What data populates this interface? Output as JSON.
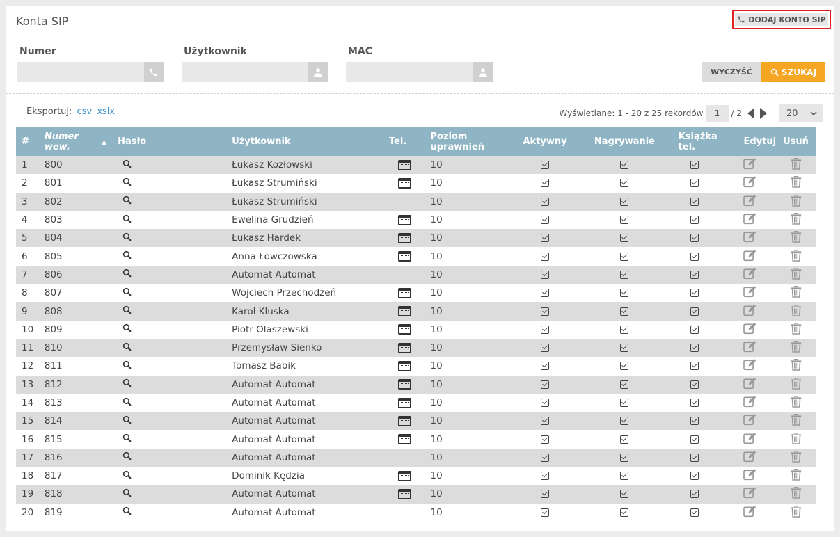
{
  "header": {
    "title": "Konta SIP",
    "add_button_label": "DODAJ KONTO SIP"
  },
  "filters": {
    "numer_label": "Numer",
    "uzytkownik_label": "Użytkownik",
    "mac_label": "MAC",
    "clear_label": "WYCZYŚĆ",
    "search_label": "SZUKAJ"
  },
  "export": {
    "label": "Eksportuj:",
    "csv": "csv",
    "xslx": "xslx"
  },
  "pager": {
    "info": "Wyświetlane: 1 - 20 z 25 rekordów",
    "current_page": "1",
    "total_pages": "/ 2",
    "per_page": "20"
  },
  "table": {
    "headers": {
      "index": "#",
      "numer_line1": "Numer",
      "numer_line2": "wew.",
      "haslo": "Hasło",
      "uzytkownik": "Użytkownik",
      "tel": "Tel.",
      "poziom_line1": "Poziom",
      "poziom_line2": "uprawnień",
      "aktywny": "Aktywny",
      "nagrywanie": "Nagrywanie",
      "ksiazka_line1": "Książka",
      "ksiazka_line2": "tel.",
      "edytuj": "Edytuj",
      "usun": "Usuń"
    },
    "rows": [
      {
        "idx": "1",
        "numer": "800",
        "user": "Łukasz Kozłowski",
        "tel": true,
        "poziom": "10"
      },
      {
        "idx": "2",
        "numer": "801",
        "user": "Łukasz Strumiński",
        "tel": true,
        "poziom": "10"
      },
      {
        "idx": "3",
        "numer": "802",
        "user": "Łukasz Strumiński",
        "tel": false,
        "poziom": "10"
      },
      {
        "idx": "4",
        "numer": "803",
        "user": "Ewelina Grudzień",
        "tel": true,
        "poziom": "10"
      },
      {
        "idx": "5",
        "numer": "804",
        "user": "Łukasz Hardek",
        "tel": true,
        "poziom": "10"
      },
      {
        "idx": "6",
        "numer": "805",
        "user": "Anna Łowczowska",
        "tel": true,
        "poziom": "10"
      },
      {
        "idx": "7",
        "numer": "806",
        "user": "Automat Automat",
        "tel": false,
        "poziom": "10"
      },
      {
        "idx": "8",
        "numer": "807",
        "user": "Wojciech Przechodzeń",
        "tel": true,
        "poziom": "10"
      },
      {
        "idx": "9",
        "numer": "808",
        "user": "Karol Kluska",
        "tel": true,
        "poziom": "10"
      },
      {
        "idx": "10",
        "numer": "809",
        "user": "Piotr Olaszewski",
        "tel": true,
        "poziom": "10"
      },
      {
        "idx": "11",
        "numer": "810",
        "user": "Przemysław Sienko",
        "tel": true,
        "poziom": "10"
      },
      {
        "idx": "12",
        "numer": "811",
        "user": "Tomasz Babik",
        "tel": true,
        "poziom": "10"
      },
      {
        "idx": "13",
        "numer": "812",
        "user": "Automat Automat",
        "tel": true,
        "poziom": "10"
      },
      {
        "idx": "14",
        "numer": "813",
        "user": "Automat Automat",
        "tel": true,
        "poziom": "10"
      },
      {
        "idx": "15",
        "numer": "814",
        "user": "Automat Automat",
        "tel": true,
        "poziom": "10"
      },
      {
        "idx": "16",
        "numer": "815",
        "user": "Automat Automat",
        "tel": true,
        "poziom": "10"
      },
      {
        "idx": "17",
        "numer": "816",
        "user": "Automat Automat",
        "tel": false,
        "poziom": "10"
      },
      {
        "idx": "18",
        "numer": "817",
        "user": "Dominik Kędzia",
        "tel": true,
        "poziom": "10"
      },
      {
        "idx": "19",
        "numer": "818",
        "user": "Automat Automat",
        "tel": true,
        "poziom": "10"
      },
      {
        "idx": "20",
        "numer": "819",
        "user": "Automat Automat",
        "tel": false,
        "poziom": "10"
      }
    ]
  },
  "colors": {
    "header_bg": "#8fb5c5",
    "search_button": "#f5a623",
    "link": "#3a8fc7",
    "highlight_border": "#e02020"
  }
}
